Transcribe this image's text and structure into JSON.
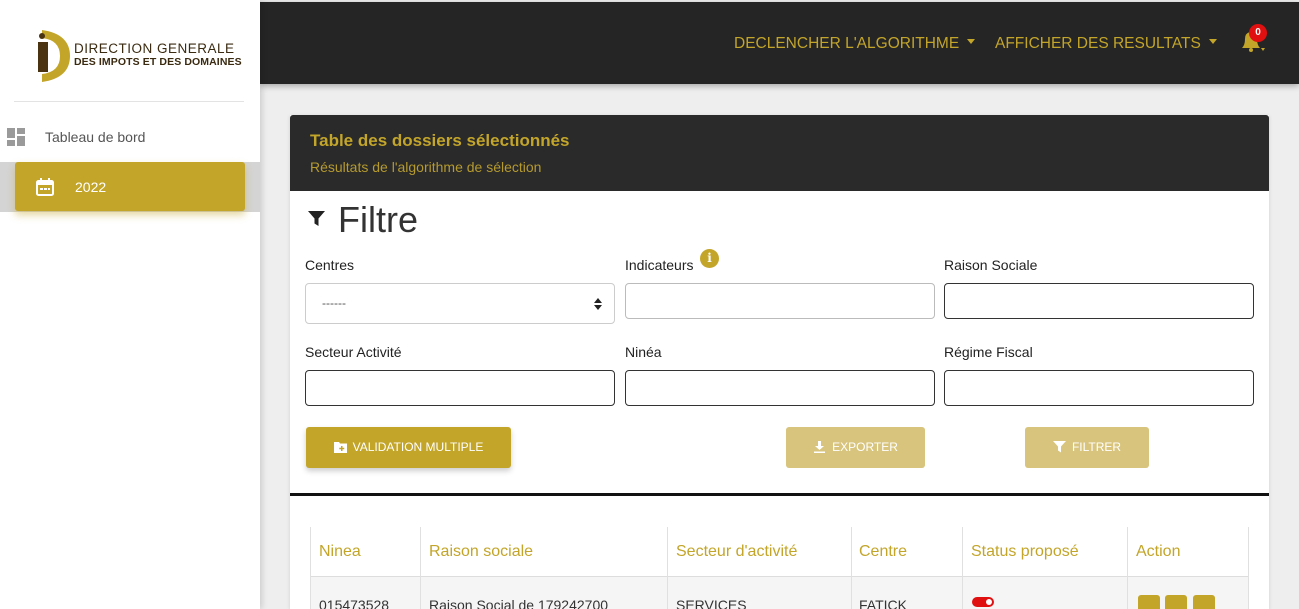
{
  "brand": {
    "line1": "DIRECTION GENERALE",
    "line2": "DES IMPOTS ET DES DOMAINES",
    "colors": {
      "gold": "#c3a52a",
      "dark": "#252525"
    }
  },
  "sidebar": {
    "items": [
      {
        "label": "Tableau de bord",
        "icon": "dashboard-icon"
      },
      {
        "label": "2022",
        "icon": "calendar-icon",
        "active": true
      }
    ]
  },
  "topbar": {
    "menu1": "DECLENCHER L'ALGORITHME",
    "menu2": "AFFICHER DES RESULTATS",
    "notifications_count": "0"
  },
  "card": {
    "title": "Table des dossiers sélectionnés",
    "subtitle": "Résultats de l'algorithme de sélection"
  },
  "filter": {
    "title": "Filtre",
    "fields": {
      "centres": {
        "label": "Centres",
        "value": "------"
      },
      "indicateurs": {
        "label": "Indicateurs",
        "value": ""
      },
      "raison_sociale": {
        "label": "Raison Sociale",
        "value": ""
      },
      "secteur": {
        "label": "Secteur Activité",
        "value": ""
      },
      "ninea": {
        "label": "Ninéa",
        "value": ""
      },
      "regime": {
        "label": "Régime Fiscal",
        "value": ""
      }
    },
    "info_icon_glyph": "i",
    "buttons": {
      "validation": "VALIDATION MULTIPLE",
      "exporter": "EXPORTER",
      "filtrer": "FILTRER"
    }
  },
  "table": {
    "headers": [
      "Ninea",
      "Raison sociale",
      "Secteur d'activité",
      "Centre",
      "Status proposé",
      "Action"
    ],
    "rows": [
      {
        "ninea": "015473528",
        "raison": "Raison Social de 179242700",
        "secteur": "SERVICES",
        "centre": "FATICK"
      }
    ]
  }
}
